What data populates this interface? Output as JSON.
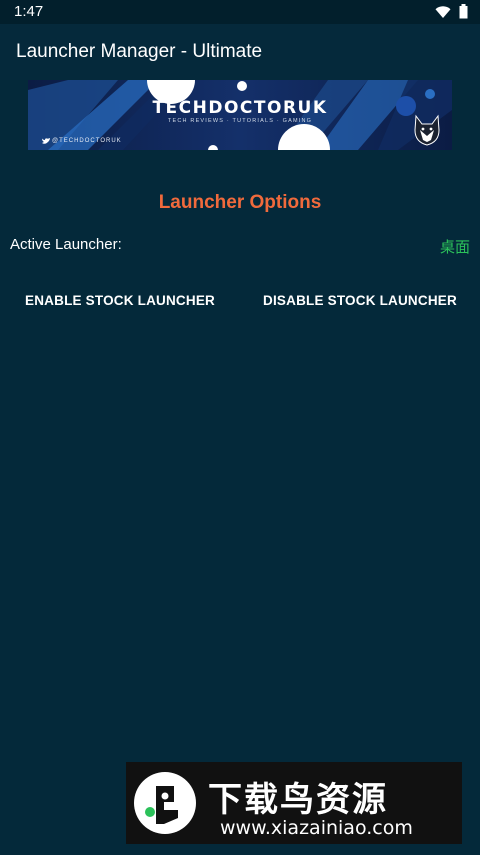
{
  "status_bar": {
    "time": "1:47",
    "icons": [
      "wifi-icon",
      "battery-icon"
    ]
  },
  "app_bar": {
    "title": "Launcher Manager - Ultimate"
  },
  "banner": {
    "title": "TECHDOCTORUK",
    "subtitle": "TECH REVIEWS · TUTORIALS · GAMING",
    "handle": "@TECHDOCTORUK",
    "icons": [
      "twitter-icon",
      "husky-logo-icon"
    ]
  },
  "content": {
    "section_title": "Launcher Options",
    "active_label": "Active Launcher:",
    "active_value": "桌面",
    "enable_button": "ENABLE STOCK LAUNCHER",
    "disable_button": "DISABLE STOCK LAUNCHER"
  },
  "watermark": {
    "cn_text": "下载鸟资源",
    "url": "www.xiazainiao.com"
  },
  "colors": {
    "background": "#04293a",
    "accent": "#f06a3c",
    "active_value": "#2bc15a"
  }
}
